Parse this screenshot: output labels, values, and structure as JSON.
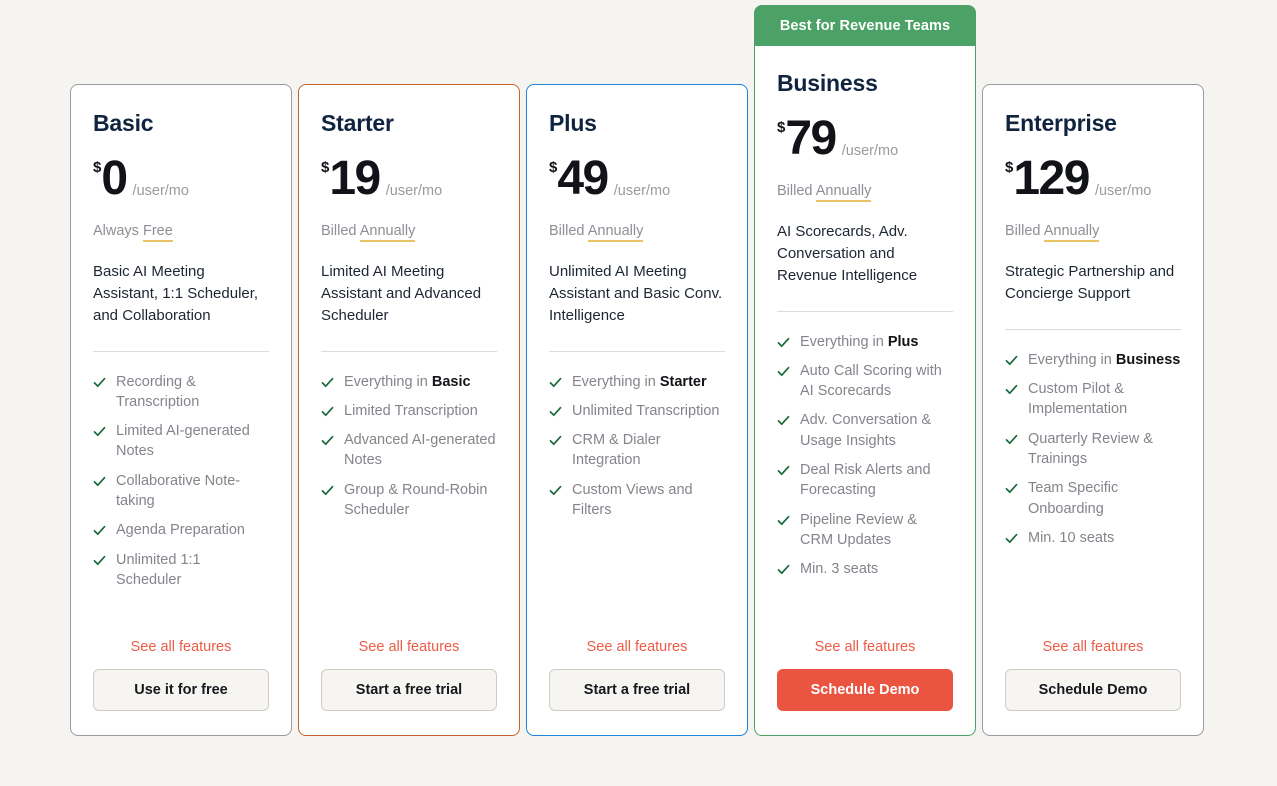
{
  "page": {
    "background_color": "#f5f4f1",
    "accent_red": "#ea5440",
    "accent_green": "#4ca266",
    "check_color": "#17693a"
  },
  "plans": [
    {
      "name": "Basic",
      "currency": "$",
      "amount": "0",
      "period": "/user/mo",
      "billing_prefix": "Always",
      "billing_highlight": "Free",
      "tagline": "Basic AI Meeting Assistant, 1:1 Scheduler, and Collaboration",
      "accent": "gray",
      "border_color": "#9b9aa0",
      "badge": null,
      "features": [
        {
          "text": "Recording & Transcription",
          "bold": ""
        },
        {
          "text": "Limited AI-generated Notes",
          "bold": ""
        },
        {
          "text": "Collaborative Note-taking",
          "bold": ""
        },
        {
          "text": "Agenda Preparation",
          "bold": ""
        },
        {
          "text": "Unlimited 1:1 Scheduler",
          "bold": ""
        }
      ],
      "see_all_label": "See all features",
      "cta_label": "Use it for free",
      "cta_style": "ghost"
    },
    {
      "name": "Starter",
      "currency": "$",
      "amount": "19",
      "period": "/user/mo",
      "billing_prefix": "Billed",
      "billing_highlight": "Annually",
      "tagline": "Limited AI Meeting Assistant and Advanced Scheduler",
      "accent": "orange",
      "border_color": "#c2652b",
      "badge": null,
      "features": [
        {
          "text": "Everything in ",
          "bold": "Basic"
        },
        {
          "text": "Limited Transcription",
          "bold": ""
        },
        {
          "text": "Advanced AI-generated Notes",
          "bold": ""
        },
        {
          "text": "Group & Round-Robin Scheduler",
          "bold": ""
        }
      ],
      "see_all_label": "See all features",
      "cta_label": "Start a free trial",
      "cta_style": "ghost"
    },
    {
      "name": "Plus",
      "currency": "$",
      "amount": "49",
      "period": "/user/mo",
      "billing_prefix": "Billed",
      "billing_highlight": "Annually",
      "tagline": "Unlimited AI Meeting Assistant and Basic Conv. Intelligence",
      "accent": "blue",
      "border_color": "#1a84e0",
      "badge": null,
      "features": [
        {
          "text": "Everything in ",
          "bold": "Starter"
        },
        {
          "text": "Unlimited Transcription",
          "bold": ""
        },
        {
          "text": "CRM & Dialer Integration",
          "bold": ""
        },
        {
          "text": "Custom Views and Filters",
          "bold": ""
        }
      ],
      "see_all_label": "See all features",
      "cta_label": "Start a free trial",
      "cta_style": "ghost"
    },
    {
      "name": "Business",
      "currency": "$",
      "amount": "79",
      "period": "/user/mo",
      "billing_prefix": "Billed",
      "billing_highlight": "Annually",
      "tagline": "AI Scorecards, Adv. Conversation and Revenue Intelligence",
      "accent": "green",
      "border_color": "#4ca266",
      "badge": "Best for Revenue Teams",
      "features": [
        {
          "text": "Everything in ",
          "bold": "Plus"
        },
        {
          "text": "Auto Call Scoring with AI Scorecards",
          "bold": ""
        },
        {
          "text": "Adv. Conversation & Usage Insights",
          "bold": ""
        },
        {
          "text": "Deal Risk Alerts and Forecasting",
          "bold": ""
        },
        {
          "text": "Pipeline Review & CRM Updates",
          "bold": ""
        },
        {
          "text": "Min. 3 seats",
          "bold": ""
        }
      ],
      "see_all_label": "See all features",
      "cta_label": "Schedule Demo",
      "cta_style": "primary"
    },
    {
      "name": "Enterprise",
      "currency": "$",
      "amount": "129",
      "period": "/user/mo",
      "billing_prefix": "Billed",
      "billing_highlight": "Annually",
      "tagline": "Strategic Partnership and Concierge Support",
      "accent": "gray",
      "border_color": "#9b9aa0",
      "badge": null,
      "features": [
        {
          "text": "Everything in ",
          "bold": "Business"
        },
        {
          "text": "Custom Pilot & Implementation",
          "bold": ""
        },
        {
          "text": "Quarterly Review & Trainings",
          "bold": ""
        },
        {
          "text": "Team Specific Onboarding",
          "bold": ""
        },
        {
          "text": "Min. 10 seats",
          "bold": ""
        }
      ],
      "see_all_label": "See all features",
      "cta_label": "Schedule Demo",
      "cta_style": "ghost"
    }
  ]
}
